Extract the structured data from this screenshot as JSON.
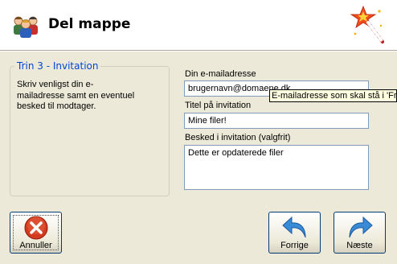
{
  "header": {
    "title": "Del mappe",
    "icon": "people-share-icon",
    "decoration_icon": "magic-wand-icon"
  },
  "step": {
    "title": "Trin 3 - Invitation",
    "description": "Skriv venligst din e-mailadresse samt en eventuel besked til modtager."
  },
  "form": {
    "email_label": "Din e-mailadresse",
    "email_value": "brugernavn@domaene.dk",
    "email_tooltip": "E-mailadresse som skal stå i 'Fra'",
    "title_label": "Titel på invitation",
    "title_value": "Mine filer!",
    "message_label": "Besked i invitation (valgfrit)",
    "message_value": "Dette er opdaterede filer"
  },
  "buttons": {
    "cancel_label": "Annuller",
    "back_label": "Forrige",
    "next_label": "Næste"
  },
  "colors": {
    "group_title": "#0046d5",
    "dialog_bg": "#ece9d8",
    "cancel_icon": "#d33a1e",
    "arrow_icon": "#3a8ad6"
  }
}
